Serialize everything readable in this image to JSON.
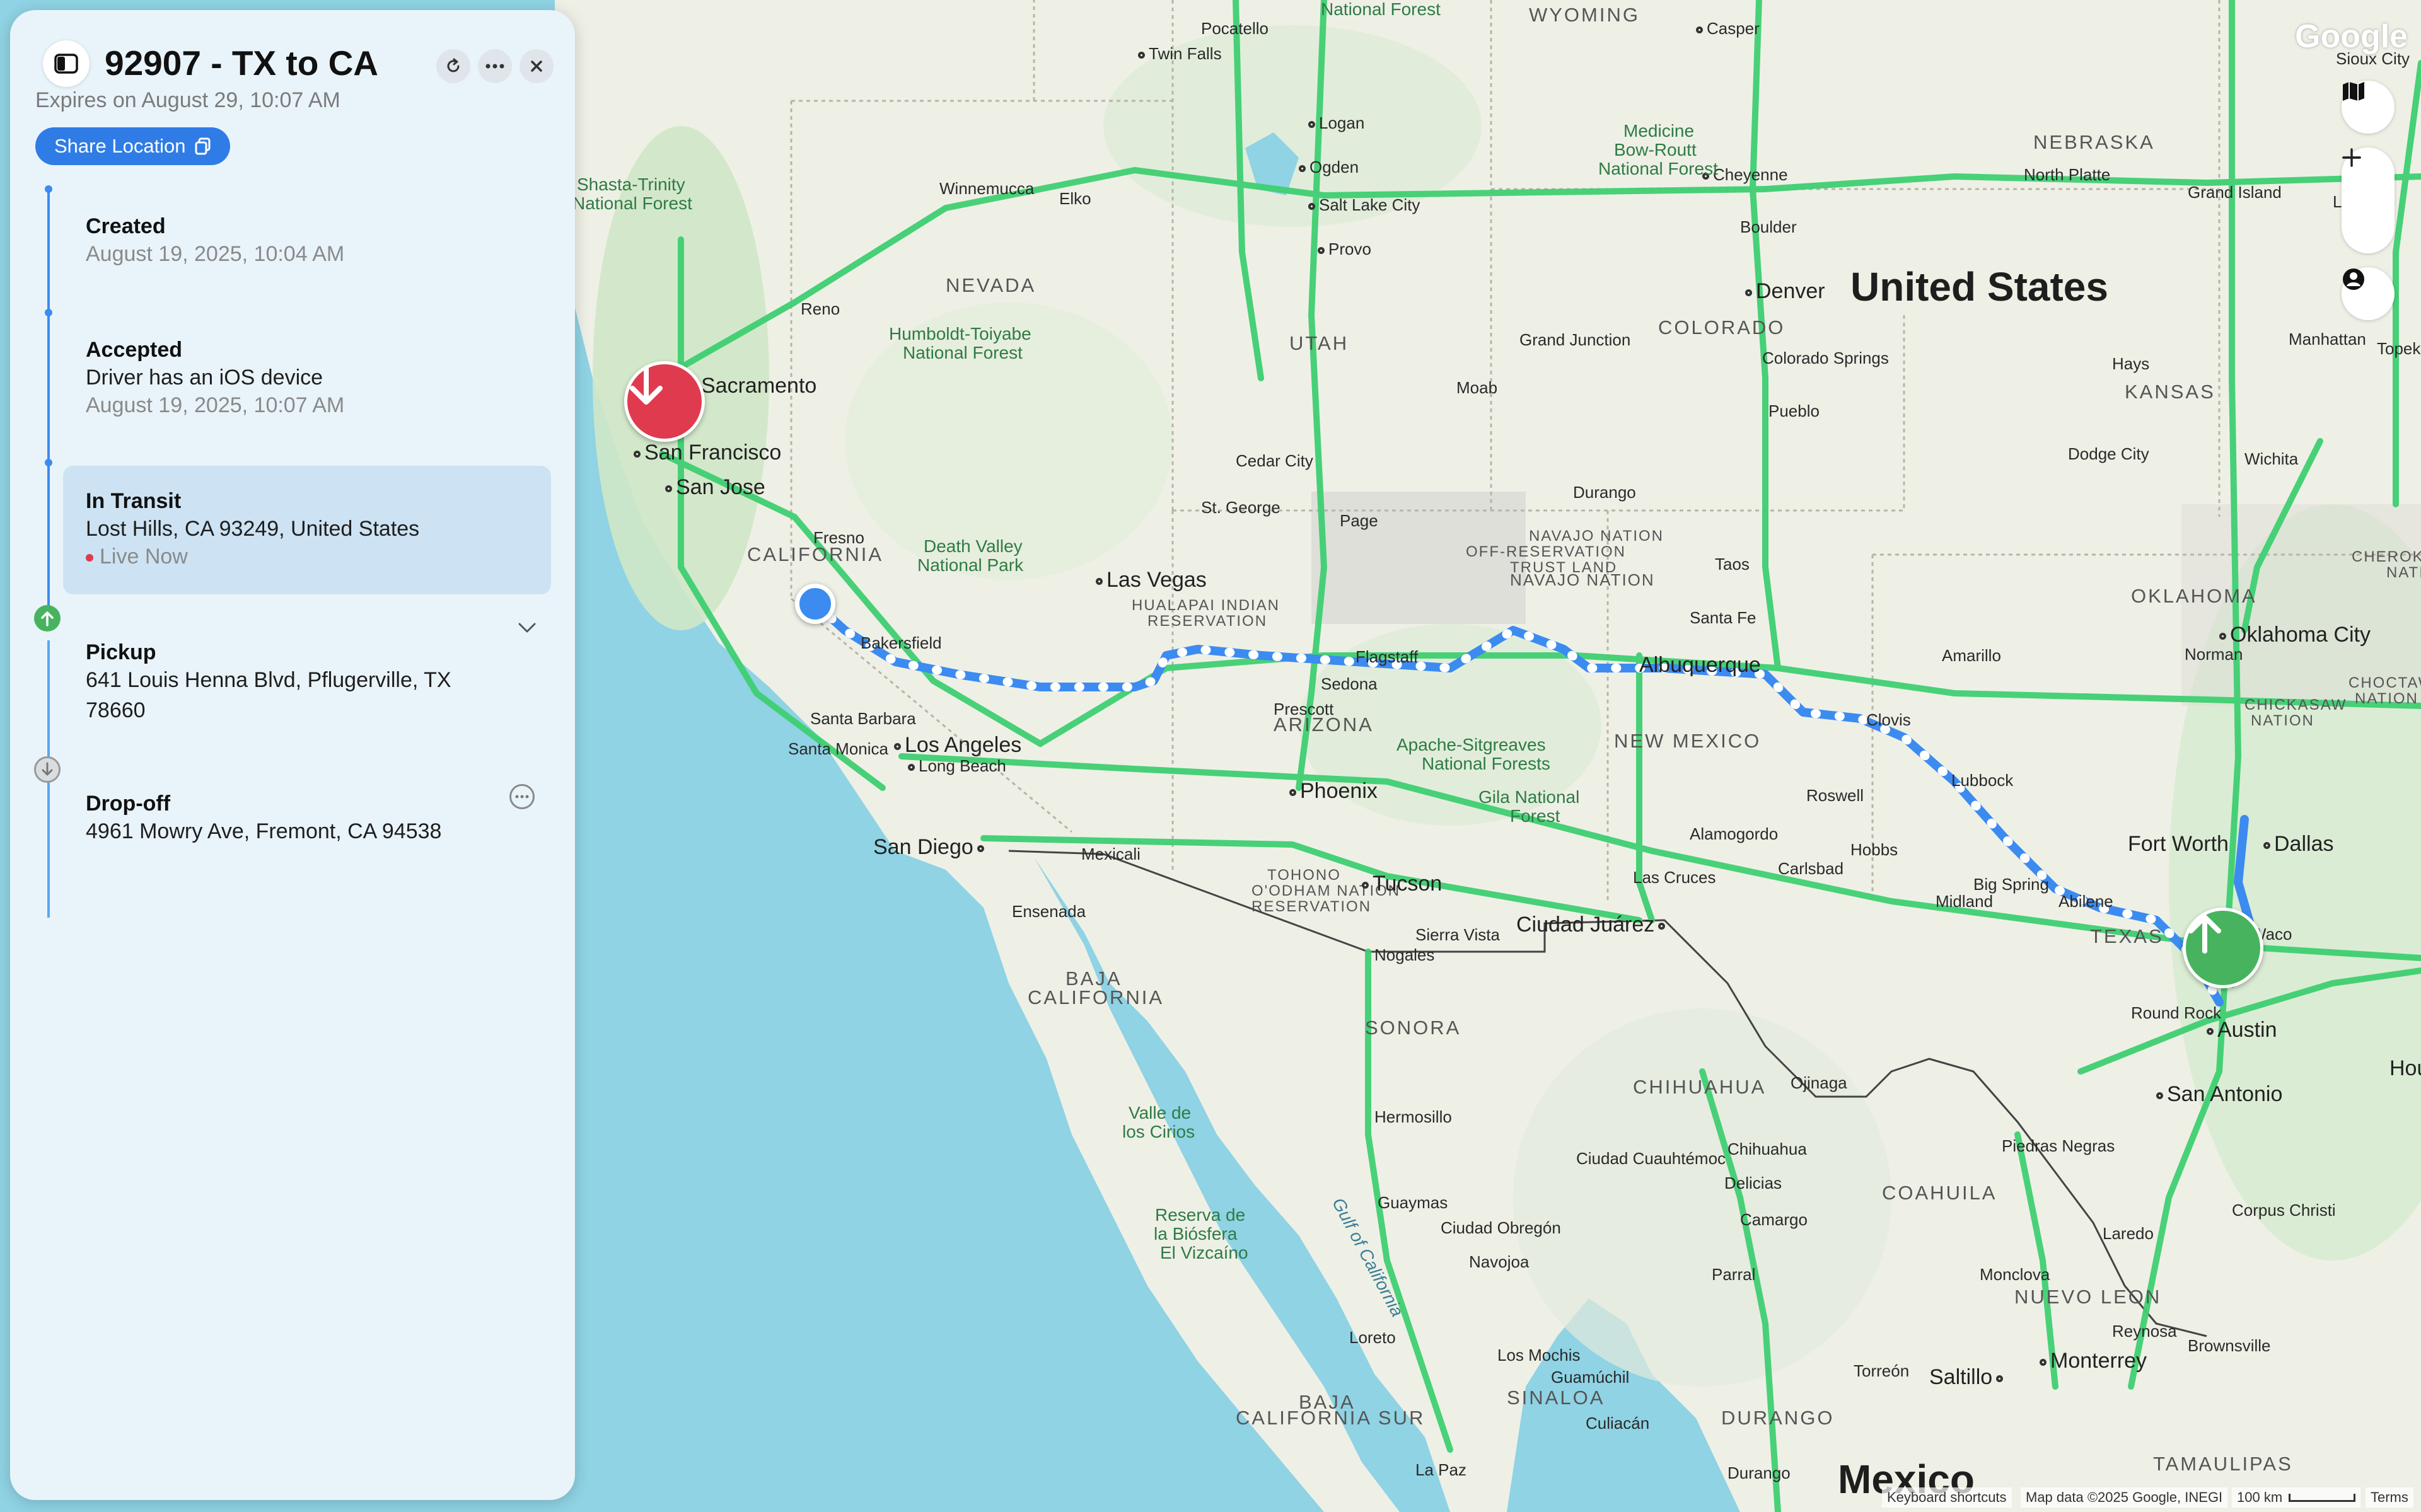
{
  "panel": {
    "title": "92907 - TX to CA",
    "expires": "Expires on August 29, 10:07 AM",
    "share_label": "Share Location",
    "events": [
      {
        "title": "Created",
        "time": "August 19, 2025, 10:04 AM"
      },
      {
        "title": "Accepted",
        "text": "Driver has an iOS device",
        "time": "August 19, 2025, 10:07 AM"
      },
      {
        "title": "In Transit",
        "text": "Lost Hills, CA 93249, United States",
        "live": "Live Now"
      },
      {
        "title": "Pickup",
        "text1": "641 Louis Henna Blvd, Pflugerville, TX",
        "text2": "78660"
      },
      {
        "title": "Drop-off",
        "text": "4961 Mowry Ave, Fremont, CA 94538"
      }
    ]
  },
  "map": {
    "watermark": "Google",
    "country_us": "United States",
    "country_mx": "Mexico",
    "states": [
      "WYOMING",
      "NEVADA",
      "UTAH",
      "COLORADO",
      "NEBRASKA",
      "KANSAS",
      "CALIFORNIA",
      "ARIZONA",
      "NEW MEXICO",
      "OKLAHOMA",
      "TEXAS",
      "BAJA",
      "CALIFORNIA",
      "SONORA",
      "CHIHUAHUA",
      "COAHUILA",
      "NUEVO LEON",
      "BAJA",
      "CALIFORNIA SUR",
      "DURANGO",
      "SINALOA",
      "TAMAULIPAS",
      "NAVAJO NATION",
      "NAVAJO NATION",
      "OFF-RESERVATION",
      "TRUST LAND",
      "HUALAPAI INDIAN",
      "RESERVATION",
      "TOHONO",
      "O'ODHAM NATION",
      "RESERVATION",
      "CHEROKEE",
      "NATION",
      "CHOCTAW",
      "NATION",
      "CHICKASAW",
      "NATION"
    ],
    "cities_big": [
      "Sacramento",
      "San Francisco",
      "San Jose",
      "Las Vegas",
      "Los Angeles",
      "Long Beach",
      "San Diego",
      "Phoenix",
      "Tucson",
      "Denver",
      "Oklahoma City",
      "Fort Worth",
      "Dallas",
      "Austin",
      "San Antonio",
      "Houston",
      "Ciudad Juárez",
      "Monterrey",
      "Saltillo"
    ],
    "cities_small": [
      "Pocatello",
      "Casper",
      "Twin Falls",
      "Logan",
      "Ogden",
      "Salt Lake City",
      "Provo",
      "Cheyenne",
      "North Platte",
      "Grand Island",
      "Lincoln",
      "Sioux City",
      "Boulder",
      "Colorado Springs",
      "Pueblo",
      "Grand Junction",
      "Moab",
      "Reno",
      "Winnemucca",
      "Elko",
      "Fresno",
      "Bakersfield",
      "Santa Barbara",
      "Santa Monica",
      "Cedar City",
      "St. George",
      "Page",
      "Flagstaff",
      "Sedona",
      "Prescott",
      "Durango",
      "Taos",
      "Santa Fe",
      "Albuquerque",
      "Amarillo",
      "Clovis",
      "Lubbock",
      "Roswell",
      "Alamogordo",
      "Las Cruces",
      "Hobbs",
      "Carlsbad",
      "Midland",
      "Big Spring",
      "Abilene",
      "Waco",
      "Round Rock",
      "Manhattan",
      "Topeka",
      "Hays",
      "Dodge City",
      "Wichita",
      "Norman",
      "Ensenada",
      "Mexicali",
      "Sierra Vista",
      "Nogales",
      "Hermosillo",
      "Guaymas",
      "Ciudad Obregón",
      "Navojoa",
      "Los Mochis",
      "Guamúchil",
      "Culiacán",
      "La Paz",
      "Loreto",
      "Ojinaga",
      "Chihuahua",
      "Delicias",
      "Camargo",
      "Parral",
      "Ciudad Cuauhtémoc",
      "Piedras Negras",
      "Monclova",
      "Laredo",
      "Reynosa",
      "Brownsville",
      "Corpus Christi",
      "Torreón",
      "Durango"
    ],
    "parks": [
      "National Forest",
      "Shasta-Trinity",
      "National Forest",
      "Humboldt-Toiyabe",
      "National Forest",
      "Death Valley",
      "National Park",
      "Medicine",
      "Bow-Routt",
      "National Forest",
      "Apache-Sitgreaves",
      "National Forests",
      "Gila National",
      "Forest",
      "Valle de",
      "los Cirios",
      "Reserva de",
      "la Biósfera",
      "El Vizcaíno"
    ],
    "water": "Gulf of California",
    "footer": [
      "Keyboard shortcuts",
      "Map data ©2025 Google, INEGI",
      "100 km",
      "Terms"
    ]
  },
  "colors": {
    "water": "#8fd3e4",
    "land": "#eef0e6",
    "highway": "#3fcf72",
    "route": "#3c8bf0",
    "accent": "#2f7ce6",
    "dropoff_pin": "#e03a4f",
    "pickup_pin": "#48b35e"
  },
  "icons": [
    "sidebar-toggle-icon",
    "refresh-icon",
    "more-icon",
    "close-icon",
    "copy-icon",
    "chevron-down-icon",
    "ellipsis-icon",
    "arrow-down-icon",
    "arrow-up-icon",
    "map-layers-icon",
    "zoom-in-icon",
    "zoom-out-icon",
    "user-icon"
  ]
}
